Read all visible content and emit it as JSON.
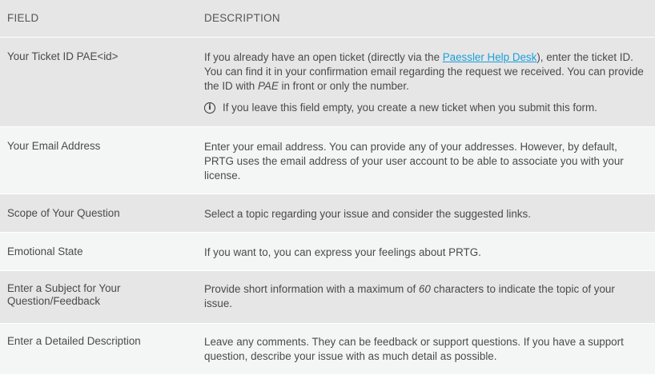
{
  "header": {
    "field": "FIELD",
    "description": "DESCRIPTION"
  },
  "rows": [
    {
      "field": "Your Ticket ID PAE<id>",
      "desc_before_link": "If you already have an open ticket (directly via the ",
      "link_text": "Paessler Help Desk",
      "desc_after_link": "), enter the ticket ID. You can find it in your confirmation email regarding the request we received. You can provide the ID with ",
      "desc_em": "PAE",
      "desc_end": " in front or only the number.",
      "note": "If you leave this field empty, you create a new ticket when you submit this form.",
      "note_icon": "info-icon"
    },
    {
      "field": "Your Email Address",
      "description": "Enter your email address. You can provide any of your addresses. However, by default, PRTG uses the email address of your user account to be able to associate you with your license."
    },
    {
      "field": "Scope of Your Question",
      "description": "Select a topic regarding your issue and consider the suggested links."
    },
    {
      "field": "Emotional State",
      "description": "If you want to, you can express your feelings about PRTG."
    },
    {
      "field": "Enter a Subject for Your Question/Feedback",
      "desc_before_em": "Provide short information with a maximum of ",
      "desc_em": "60",
      "desc_after_em": " characters to indicate the topic of your issue."
    },
    {
      "field": "Enter a Detailed Description",
      "description": "Leave any comments. They can be feedback or support questions. If you have a support question, describe your issue with as much detail as possible."
    }
  ],
  "colors": {
    "header_bg": "#e6e6e6",
    "row_alt_bg": "#f4f6f5",
    "link": "#1a9fd9",
    "text": "#4a4a4a"
  }
}
